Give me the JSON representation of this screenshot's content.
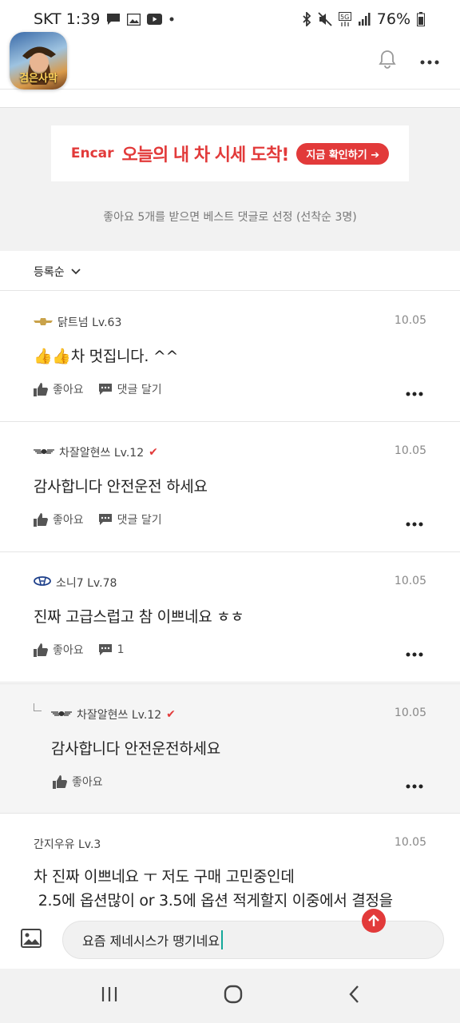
{
  "status_bar": {
    "carrier_time": "SKT 1:39",
    "battery": "76%",
    "icons": [
      "chat-icon",
      "gallery-icon",
      "youtube-icon",
      "dot-icon",
      "bluetooth-icon",
      "mute-icon",
      "5g-icon",
      "signal-icon",
      "battery-icon"
    ]
  },
  "app_bar": {
    "logo_text": "검은사막",
    "icons": [
      "bell-icon",
      "more-vertical-icon"
    ]
  },
  "banner": {
    "brand": "Encar",
    "headline": "오늘의 내 차 시세 도착!",
    "cta": "지금 확인하기 ➔"
  },
  "best_note": "좋아요 5개를 받으면 베스트 댓글로 선정 (선착순 3명)",
  "sort": {
    "label": "등록순"
  },
  "comments": [
    {
      "user": "닭트넘 Lv.63",
      "date": "10.05",
      "body": "👍👍차 멋집니다. ^^",
      "like_label": "좋아요",
      "reply_label": "댓글 달기"
    },
    {
      "user": "차잘알현쓰 Lv.12",
      "date": "10.05",
      "body": "감사합니다 안전운전 하세요",
      "like_label": "좋아요",
      "reply_label": "댓글 달기"
    },
    {
      "user": "소니7 Lv.78",
      "date": "10.05",
      "body": "진짜 고급스럽고 참 이쁘네요 ㅎㅎ",
      "like_label": "좋아요",
      "reply_count": "1"
    },
    {
      "user": "차잘알현쓰 Lv.12",
      "date": "10.05",
      "body": "감사합니다 안전운전하세요",
      "like_label": "좋아요"
    },
    {
      "user": "간지우유 Lv.3",
      "date": "10.05",
      "body_line1": "차 진짜 이쁘네요 ㅜ 저도 구매 고민중인데",
      "body_line2": " 2.5에 옵션많이 or 3.5에 옵션 적게할지 이중에서 결정을"
    }
  ],
  "input": {
    "value": "요즘 제네시스가 땡기네요"
  },
  "colors": {
    "accent": "#e23a3a",
    "caret": "#14a89a",
    "gray_bg": "#f2f2f2"
  }
}
